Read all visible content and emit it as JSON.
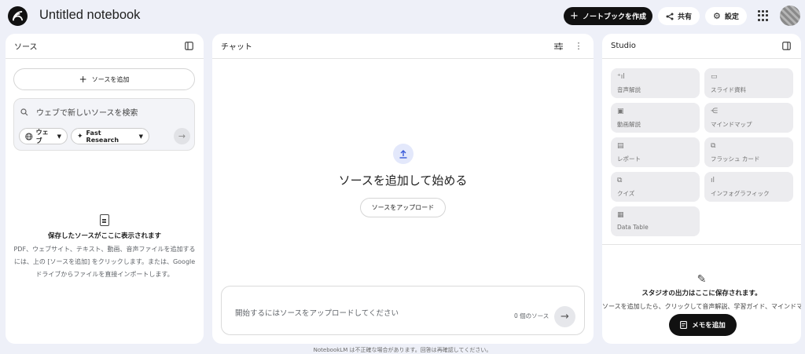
{
  "header": {
    "title": "Untitled notebook",
    "create_label": "ノートブックを作成",
    "share_label": "共有",
    "settings_label": "設定"
  },
  "sources_panel": {
    "title": "ソース",
    "add_source_label": "ソースを追加",
    "search_placeholder": "ウェブで新しいソースを検索",
    "web_chip_label": "ウェブ",
    "research_chip_label": "Fast Research",
    "empty_title": "保存したソースがここに表示されます",
    "empty_description": "PDF、ウェブサイト、テキスト、動画、音声ファイルを追加するには、上の [ソースを追加] をクリックします。または、Google ドライブからファイルを直接インポートします。"
  },
  "chat_panel": {
    "title": "チャット",
    "heading": "ソースを追加して始める",
    "upload_label": "ソースをアップロード",
    "input_placeholder": "開始するにはソースをアップロードしてください",
    "source_count": "0 個のソース"
  },
  "studio_panel": {
    "title": "Studio",
    "tiles": [
      {
        "label": "音声解説",
        "icon": "audio-waves-icon"
      },
      {
        "label": "スライド資料",
        "icon": "slides-icon"
      },
      {
        "label": "動画解説",
        "icon": "video-icon"
      },
      {
        "label": "マインドマップ",
        "icon": "mindmap-icon"
      },
      {
        "label": "レポート",
        "icon": "report-icon"
      },
      {
        "label": "フラッシュ カード",
        "icon": "flashcards-icon"
      },
      {
        "label": "クイズ",
        "icon": "quiz-icon"
      },
      {
        "label": "インフォグラフィック",
        "icon": "infographic-icon"
      },
      {
        "label": "Data Table",
        "icon": "table-icon"
      }
    ],
    "empty_title": "スタジオの出力はここに保存されます。",
    "empty_description": "ソースを追加したら、クリックして音声解説、学習ガイド、マインドマップなどを追加しましょう。",
    "add_note_label": "メモを追加"
  },
  "footer": {
    "disclaimer": "NotebookLM は不正確な場合があります。回答は再確認してください。"
  }
}
